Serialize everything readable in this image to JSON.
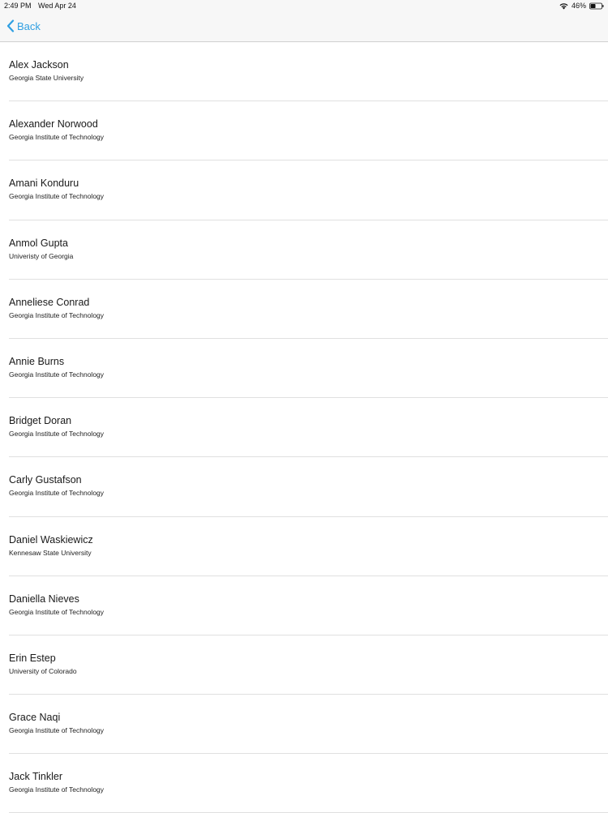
{
  "status_bar": {
    "time": "2:49 PM",
    "date": "Wed Apr 24",
    "battery": "46%",
    "battery_level": 0.46
  },
  "nav": {
    "back_label": "Back"
  },
  "people": [
    {
      "name": "Alex Jackson",
      "school": "Georgia State University"
    },
    {
      "name": "Alexander Norwood",
      "school": "Georgia Institute of Technology"
    },
    {
      "name": "Amani Konduru",
      "school": "Georgia Institute of Technology"
    },
    {
      "name": "Anmol Gupta",
      "school": "Univeristy of Georgia"
    },
    {
      "name": "Anneliese Conrad",
      "school": "Georgia Institute of Technology"
    },
    {
      "name": "Annie Burns",
      "school": "Georgia Institute of Technology"
    },
    {
      "name": "Bridget Doran",
      "school": "Georgia Institute of Technology"
    },
    {
      "name": "Carly Gustafson",
      "school": "Georgia Institute of Technology"
    },
    {
      "name": "Daniel Waskiewicz",
      "school": "Kennesaw State University"
    },
    {
      "name": "Daniella Nieves",
      "school": "Georgia Institute of Technology"
    },
    {
      "name": "Erin Estep",
      "school": "University of Colorado"
    },
    {
      "name": "Grace Naqi",
      "school": "Georgia Institute of Technology"
    },
    {
      "name": "Jack Tinkler",
      "school": "Georgia Institute of Technology"
    }
  ],
  "colors": {
    "accent": "#2f9fe2",
    "separator": "#e0e0e0"
  }
}
